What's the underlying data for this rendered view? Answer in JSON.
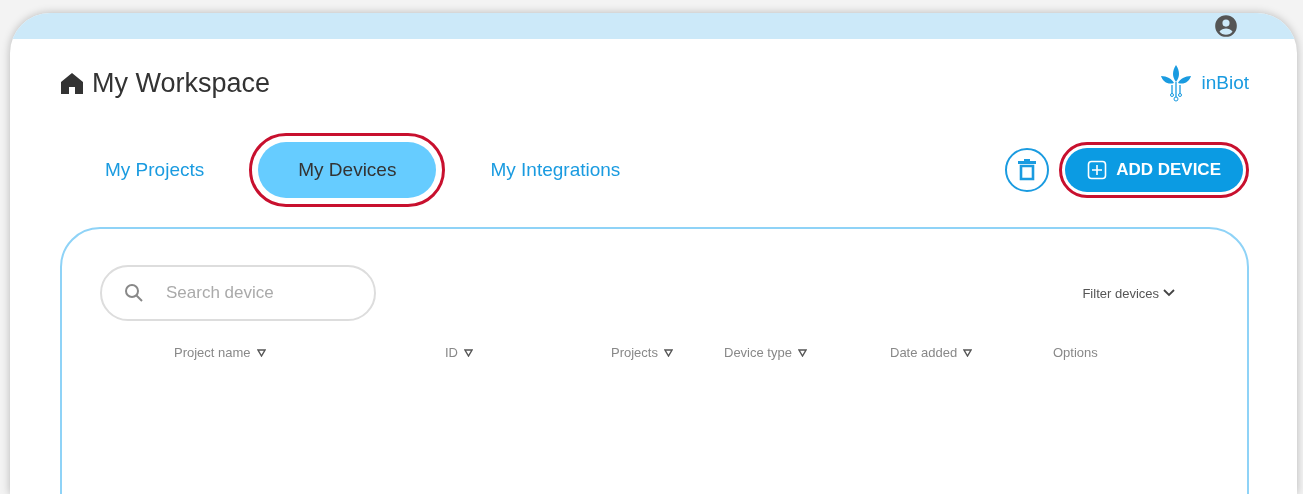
{
  "header": {
    "title": "My Workspace",
    "brand": "inBiot"
  },
  "tabs": [
    {
      "label": "My Projects",
      "selected": false,
      "highlighted": false
    },
    {
      "label": "My Devices",
      "selected": true,
      "highlighted": true
    },
    {
      "label": "My Integrations",
      "selected": false,
      "highlighted": false
    }
  ],
  "actions": {
    "add_button": {
      "label": "ADD DEVICE",
      "highlighted": true
    }
  },
  "search": {
    "placeholder": "Search device"
  },
  "filter": {
    "label": "Filter devices"
  },
  "table": {
    "columns": [
      {
        "label": "Project name",
        "sortable": true
      },
      {
        "label": "ID",
        "sortable": true
      },
      {
        "label": "Projects",
        "sortable": true
      },
      {
        "label": "Device type",
        "sortable": true
      },
      {
        "label": "Date added",
        "sortable": true
      },
      {
        "label": "Options",
        "sortable": false
      }
    ]
  }
}
